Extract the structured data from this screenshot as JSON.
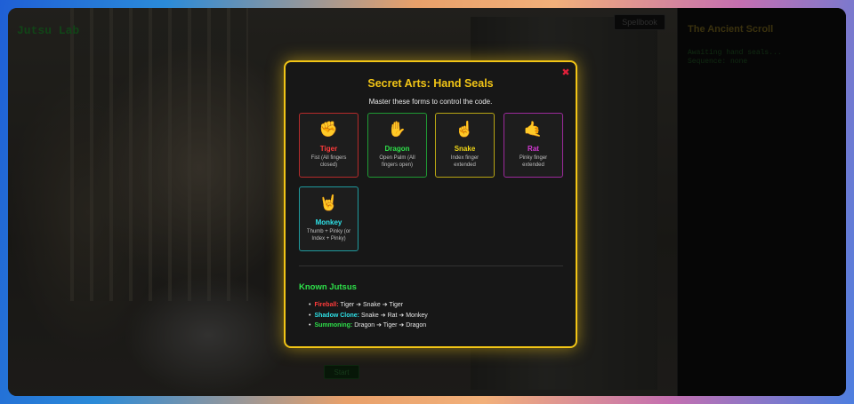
{
  "app": {
    "title": "Jutsu Lab",
    "top_button": "Spellbook",
    "bottom_button": "Start",
    "side_panel_title": "The Ancient Scroll",
    "side_line1": "Awaiting hand seals...",
    "side_line2": "Sequence: none"
  },
  "modal": {
    "title": "Secret Arts: Hand Seals",
    "subtitle": "Master these forms to control the code.",
    "close_icon": "✖",
    "seals": [
      {
        "emoji": "✊",
        "name": "Tiger",
        "desc": "Fist (All fingers closed)",
        "color": "#ff3b3b",
        "border": "#b62b2b"
      },
      {
        "emoji": "✋",
        "name": "Dragon",
        "desc": "Open Palm (All fingers open)",
        "color": "#2ee04a",
        "border": "#1f9a34"
      },
      {
        "emoji": "☝️",
        "name": "Snake",
        "desc": "Index finger extended",
        "color": "#f2d816",
        "border": "#b8a514"
      },
      {
        "emoji": "🤙",
        "name": "Rat",
        "desc": "Pinky finger extended",
        "color": "#d63ad6",
        "border": "#9c2a9c"
      },
      {
        "emoji": "🤘",
        "name": "Monkey",
        "desc": "Thumb + Pinky (or Index + Pinky)",
        "color": "#2ee0e6",
        "border": "#1f9a9e"
      }
    ],
    "jutsu_heading": "Known Jutsus",
    "jutsus": [
      {
        "name": "Fireball:",
        "sequence": "Tiger ➔ Snake ➔ Tiger",
        "color": "#ff3b3b"
      },
      {
        "name": "Shadow Clone:",
        "sequence": "Snake ➔ Rat ➔ Monkey",
        "color": "#2ee0e6"
      },
      {
        "name": "Summoning:",
        "sequence": "Dragon ➔ Tiger ➔ Dragon",
        "color": "#2ee04a"
      }
    ]
  }
}
